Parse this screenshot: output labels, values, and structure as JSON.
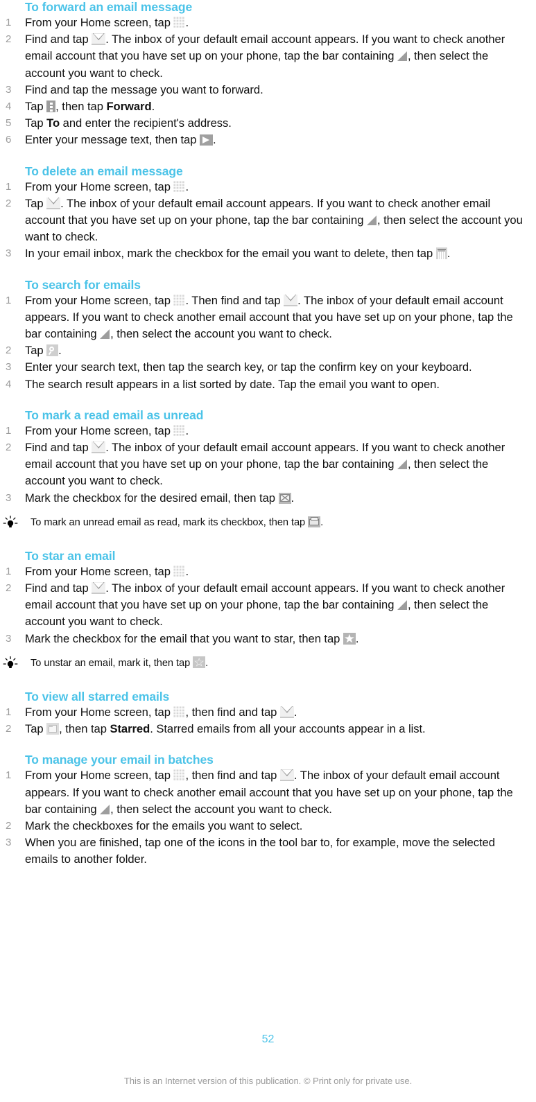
{
  "document": {
    "page_number": "52",
    "footer_note": "This is an Internet version of this publication. © Print only for private use.",
    "heading_color": "#4BC3E8",
    "step_number_color": "#9b9b9b"
  },
  "icons": {
    "app_drawer": "grid-icon",
    "email": "envelope-icon",
    "account_bar": "triangle-icon",
    "overflow_menu": "overflow-menu-icon",
    "send": "send-icon",
    "delete": "trash-icon",
    "search": "search-icon",
    "mark_unread": "unread-envelope-icon",
    "mark_read": "read-envelope-icon",
    "star": "star-icon",
    "unstar": "star-outline-icon",
    "folder": "folder-icon",
    "tip": "lightbulb-icon"
  },
  "sections": [
    {
      "id": "forward",
      "title": "To forward an email message",
      "steps": [
        {
          "parts": [
            {
              "t": "text",
              "v": "From your Home screen, tap "
            },
            {
              "t": "icon",
              "v": "app_drawer"
            },
            {
              "t": "text",
              "v": "."
            }
          ]
        },
        {
          "parts": [
            {
              "t": "text",
              "v": "Find and tap "
            },
            {
              "t": "icon",
              "v": "email"
            },
            {
              "t": "text",
              "v": ". The inbox of your default email account appears. If you want to check another email account that you have set up on your phone, tap the bar containing "
            },
            {
              "t": "icon",
              "v": "account_bar"
            },
            {
              "t": "text",
              "v": ", then select the account you want to check."
            }
          ]
        },
        {
          "parts": [
            {
              "t": "text",
              "v": "Find and tap the message you want to forward."
            }
          ]
        },
        {
          "parts": [
            {
              "t": "text",
              "v": "Tap "
            },
            {
              "t": "icon",
              "v": "overflow_menu"
            },
            {
              "t": "text",
              "v": ", then tap "
            },
            {
              "t": "bold",
              "v": "Forward"
            },
            {
              "t": "text",
              "v": "."
            }
          ]
        },
        {
          "parts": [
            {
              "t": "text",
              "v": "Tap "
            },
            {
              "t": "bold",
              "v": "To"
            },
            {
              "t": "text",
              "v": " and enter the recipient's address."
            }
          ]
        },
        {
          "parts": [
            {
              "t": "text",
              "v": "Enter your message text, then tap "
            },
            {
              "t": "icon",
              "v": "send"
            },
            {
              "t": "text",
              "v": "."
            }
          ]
        }
      ],
      "tips": []
    },
    {
      "id": "delete",
      "title": "To delete an email message",
      "steps": [
        {
          "parts": [
            {
              "t": "text",
              "v": "From your Home screen, tap "
            },
            {
              "t": "icon",
              "v": "app_drawer"
            },
            {
              "t": "text",
              "v": "."
            }
          ]
        },
        {
          "parts": [
            {
              "t": "text",
              "v": "Tap "
            },
            {
              "t": "icon",
              "v": "email"
            },
            {
              "t": "text",
              "v": ". The inbox of your default email account appears. If you want to check another email account that you have set up on your phone, tap the bar containing "
            },
            {
              "t": "icon",
              "v": "account_bar"
            },
            {
              "t": "text",
              "v": ", then select the account you want to check."
            }
          ]
        },
        {
          "parts": [
            {
              "t": "text",
              "v": "In your email inbox, mark the checkbox for the email you want to delete, then tap "
            },
            {
              "t": "icon",
              "v": "delete"
            },
            {
              "t": "text",
              "v": "."
            }
          ]
        }
      ],
      "tips": []
    },
    {
      "id": "search",
      "title": "To search for emails",
      "steps": [
        {
          "parts": [
            {
              "t": "text",
              "v": "From your Home screen, tap "
            },
            {
              "t": "icon",
              "v": "app_drawer"
            },
            {
              "t": "text",
              "v": ". Then find and tap "
            },
            {
              "t": "icon",
              "v": "email"
            },
            {
              "t": "text",
              "v": ". The inbox of your default email account appears. If you want to check another email account that you have set up on your phone, tap the bar containing "
            },
            {
              "t": "icon",
              "v": "account_bar"
            },
            {
              "t": "text",
              "v": ", then select the account you want to check."
            }
          ]
        },
        {
          "parts": [
            {
              "t": "text",
              "v": "Tap "
            },
            {
              "t": "icon",
              "v": "search"
            },
            {
              "t": "text",
              "v": "."
            }
          ]
        },
        {
          "parts": [
            {
              "t": "text",
              "v": "Enter your search text, then tap the search key, or tap the confirm key on your keyboard."
            }
          ]
        },
        {
          "parts": [
            {
              "t": "text",
              "v": "The search result appears in a list sorted by date. Tap the email you want to open."
            }
          ]
        }
      ],
      "tips": []
    },
    {
      "id": "mark-unread",
      "title": "To mark a read email as unread",
      "steps": [
        {
          "parts": [
            {
              "t": "text",
              "v": "From your Home screen, tap "
            },
            {
              "t": "icon",
              "v": "app_drawer"
            },
            {
              "t": "text",
              "v": "."
            }
          ]
        },
        {
          "parts": [
            {
              "t": "text",
              "v": "Find and tap "
            },
            {
              "t": "icon",
              "v": "email"
            },
            {
              "t": "text",
              "v": ". The inbox of your default email account appears. If you want to check another email account that you have set up on your phone, tap the bar containing "
            },
            {
              "t": "icon",
              "v": "account_bar"
            },
            {
              "t": "text",
              "v": ", then select the account you want to check."
            }
          ]
        },
        {
          "parts": [
            {
              "t": "text",
              "v": "Mark the checkbox for the desired email, then tap "
            },
            {
              "t": "icon",
              "v": "mark_unread"
            },
            {
              "t": "text",
              "v": "."
            }
          ]
        }
      ],
      "tips": [
        {
          "parts": [
            {
              "t": "text",
              "v": "To mark an unread email as read, mark its checkbox, then tap "
            },
            {
              "t": "icon",
              "v": "mark_read"
            },
            {
              "t": "text",
              "v": "."
            }
          ]
        }
      ]
    },
    {
      "id": "star",
      "title": "To star an email",
      "steps": [
        {
          "parts": [
            {
              "t": "text",
              "v": "From your Home screen, tap "
            },
            {
              "t": "icon",
              "v": "app_drawer"
            },
            {
              "t": "text",
              "v": "."
            }
          ]
        },
        {
          "parts": [
            {
              "t": "text",
              "v": "Find and tap "
            },
            {
              "t": "icon",
              "v": "email"
            },
            {
              "t": "text",
              "v": ". The inbox of your default email account appears. If you want to check another email account that you have set up on your phone, tap the bar containing "
            },
            {
              "t": "icon",
              "v": "account_bar"
            },
            {
              "t": "text",
              "v": ", then select the account you want to check."
            }
          ]
        },
        {
          "parts": [
            {
              "t": "text",
              "v": "Mark the checkbox for the email that you want to star, then tap "
            },
            {
              "t": "icon",
              "v": "star"
            },
            {
              "t": "text",
              "v": "."
            }
          ]
        }
      ],
      "tips": [
        {
          "parts": [
            {
              "t": "text",
              "v": "To unstar an email, mark it, then tap "
            },
            {
              "t": "icon",
              "v": "unstar"
            },
            {
              "t": "text",
              "v": "."
            }
          ]
        }
      ]
    },
    {
      "id": "view-starred",
      "title": "To view all starred emails",
      "steps": [
        {
          "parts": [
            {
              "t": "text",
              "v": "From your Home screen, tap "
            },
            {
              "t": "icon",
              "v": "app_drawer"
            },
            {
              "t": "text",
              "v": ", then find and tap "
            },
            {
              "t": "icon",
              "v": "email"
            },
            {
              "t": "text",
              "v": "."
            }
          ]
        },
        {
          "parts": [
            {
              "t": "text",
              "v": "Tap "
            },
            {
              "t": "icon",
              "v": "folder"
            },
            {
              "t": "text",
              "v": ", then tap "
            },
            {
              "t": "bold",
              "v": "Starred"
            },
            {
              "t": "text",
              "v": ". Starred emails from all your accounts appear in a list."
            }
          ]
        }
      ],
      "tips": []
    },
    {
      "id": "batches",
      "title": "To manage your email in batches",
      "steps": [
        {
          "parts": [
            {
              "t": "text",
              "v": "From your Home screen, tap "
            },
            {
              "t": "icon",
              "v": "app_drawer"
            },
            {
              "t": "text",
              "v": ", then find and tap "
            },
            {
              "t": "icon",
              "v": "email"
            },
            {
              "t": "text",
              "v": ". The inbox of your default email account appears. If you want to check another email account that you have set up on your phone, tap the bar containing "
            },
            {
              "t": "icon",
              "v": "account_bar"
            },
            {
              "t": "text",
              "v": ", then select the account you want to check."
            }
          ]
        },
        {
          "parts": [
            {
              "t": "text",
              "v": "Mark the checkboxes for the emails you want to select."
            }
          ]
        },
        {
          "parts": [
            {
              "t": "text",
              "v": "When you are finished, tap one of the icons in the tool bar to, for example, move the selected emails to another folder."
            }
          ]
        }
      ],
      "tips": []
    }
  ]
}
